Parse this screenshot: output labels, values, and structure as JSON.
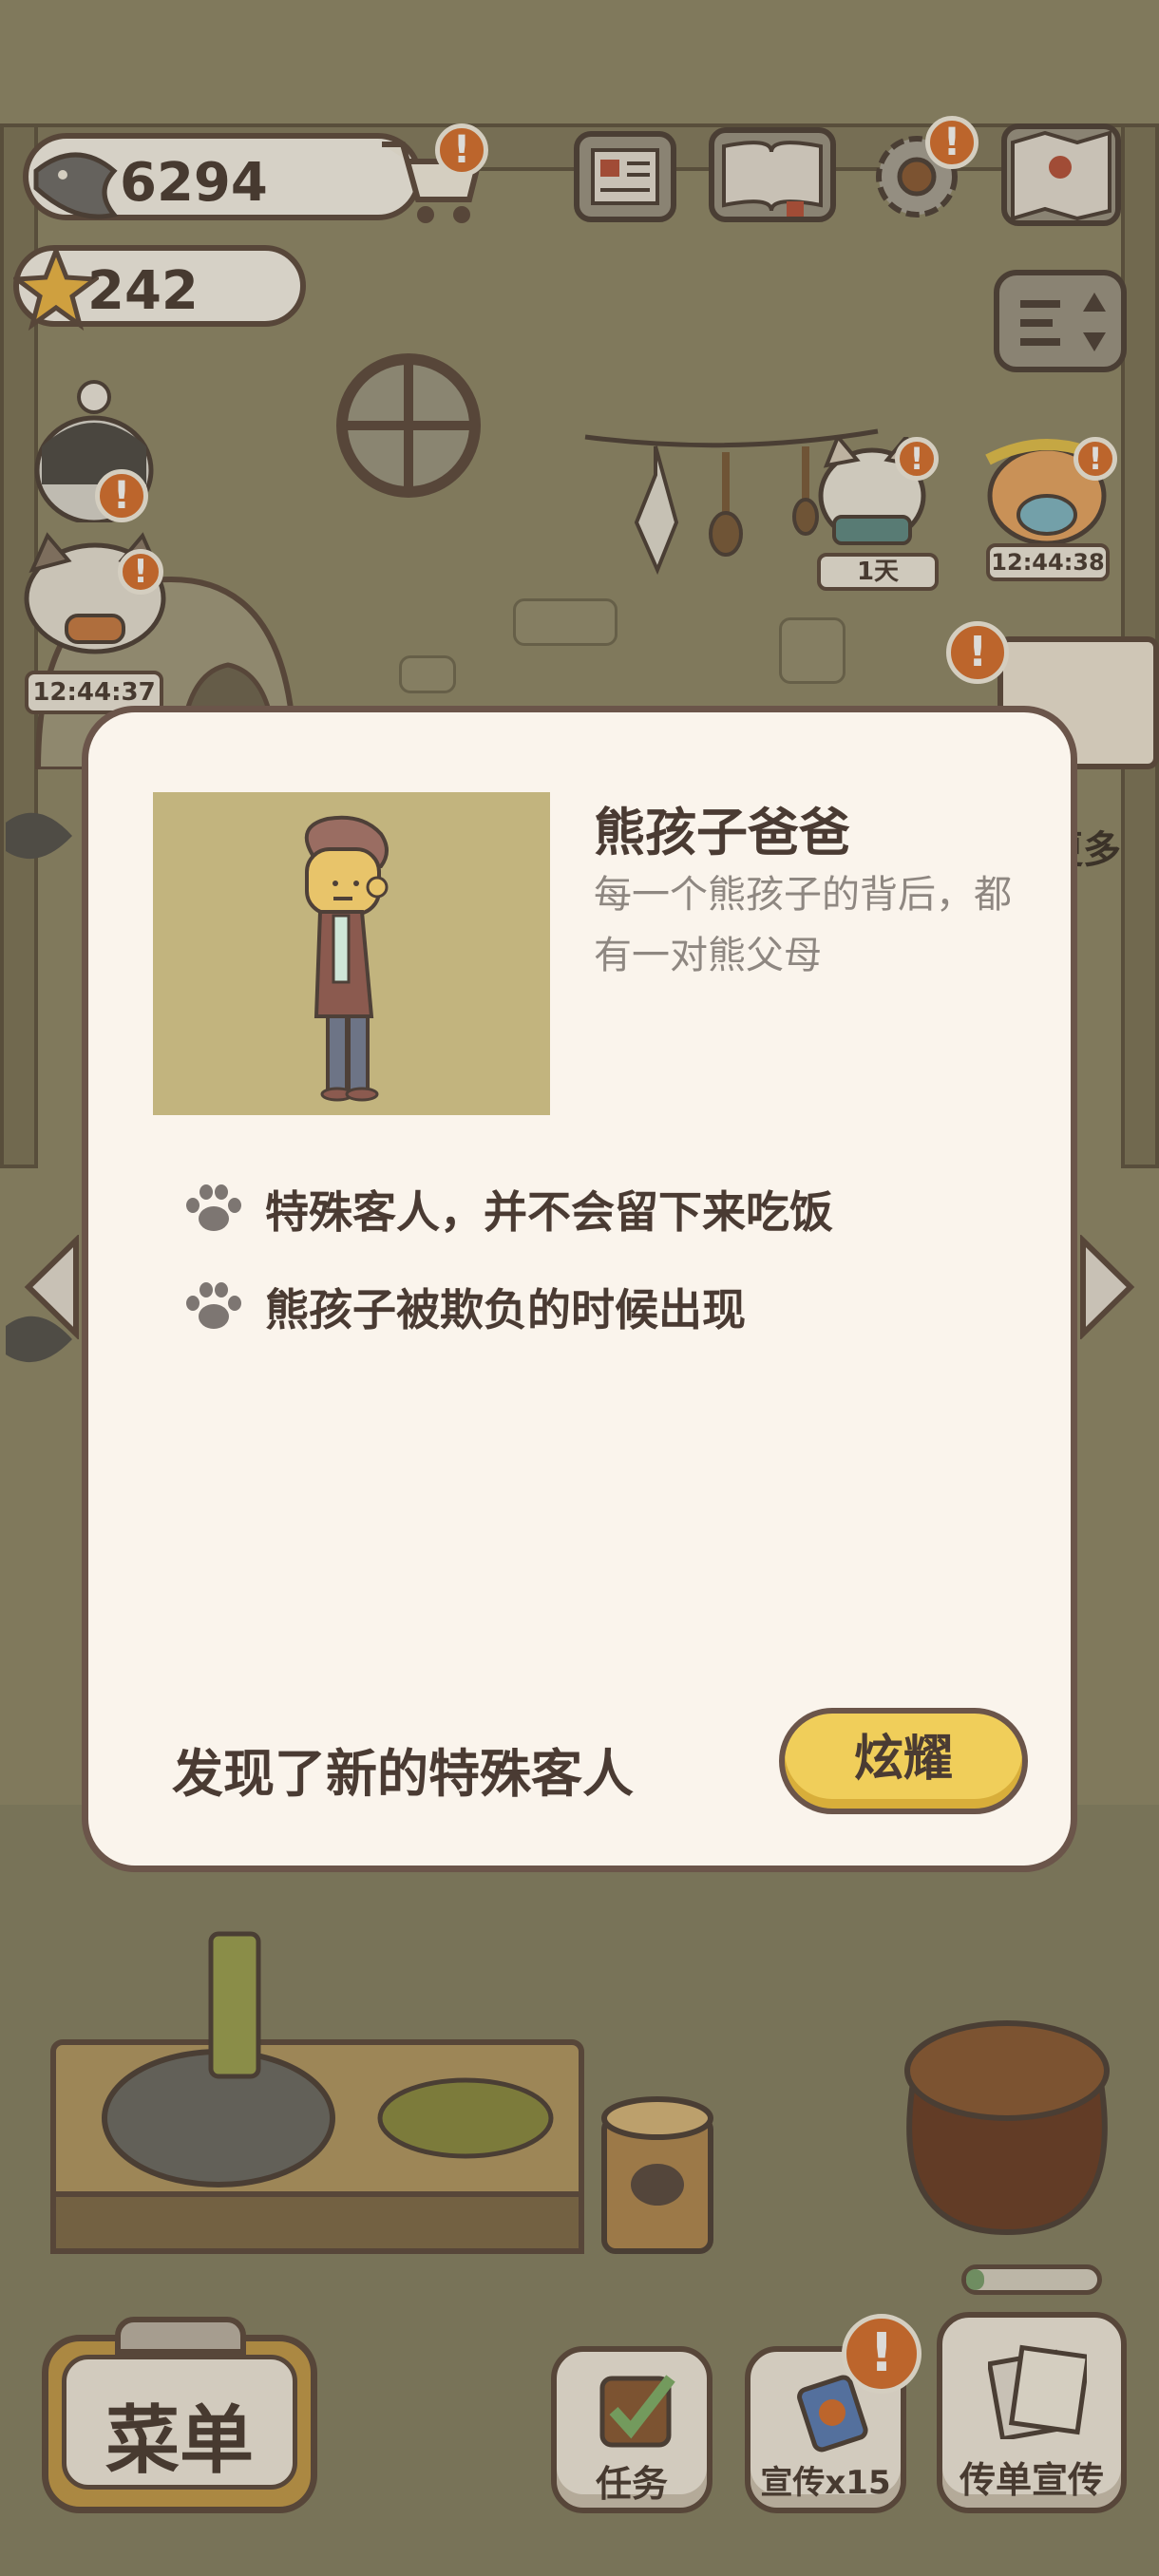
{
  "currency": {
    "fish": "6294",
    "stars": "242"
  },
  "top_icons": {
    "cart_badge": "!",
    "newspaper": "newspaper-icon",
    "recipe_book": "recipe-book-icon",
    "settings": "gear-icon",
    "settings_badge": "!",
    "map": "map-icon",
    "sort": "sort-icon"
  },
  "customers": {
    "left_timer": "12:44:37",
    "right_timer_1": "1天",
    "right_timer_2": "12:44:38"
  },
  "background_text": {
    "more": "更多"
  },
  "modal": {
    "name": "熊孩子爸爸",
    "description": "每一个熊孩子的背后，都有一对熊父母",
    "traits": [
      "特殊客人，并不会留下来吃饭",
      "熊孩子被欺负的时候出现"
    ],
    "found_text": "发现了新的特殊客人",
    "show_button": "炫耀"
  },
  "bottom_bar": {
    "menu": "菜单",
    "tasks": "任务",
    "promote": "宣传x15",
    "flyer": "传单宣传"
  },
  "colors": {
    "border": "#5d4a3e",
    "accent": "#f0ce5a",
    "badge": "#d8702e",
    "modal_bg": "#faf4ec"
  }
}
